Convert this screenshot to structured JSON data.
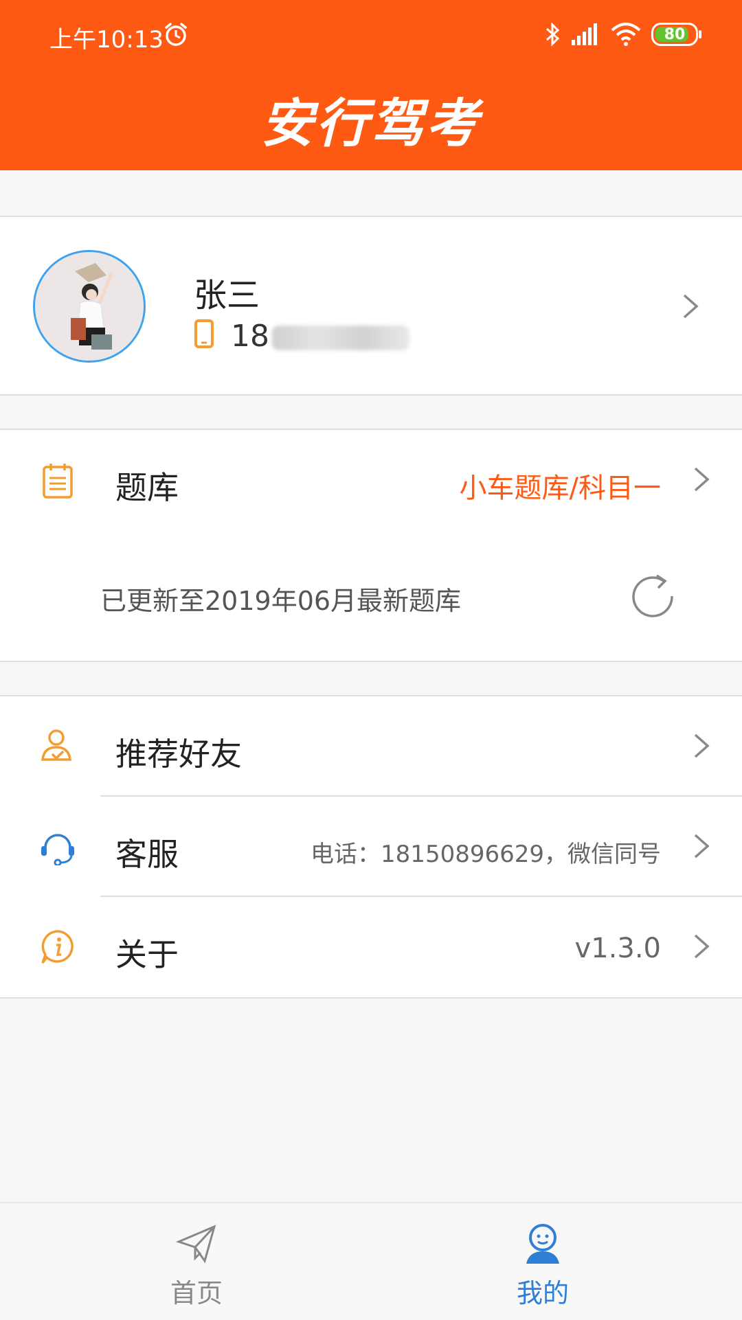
{
  "status_bar": {
    "time": "上午10:13",
    "battery": "80"
  },
  "app": {
    "title": "安行驾考"
  },
  "profile": {
    "name": "张三",
    "phone_prefix": "18"
  },
  "question_bank": {
    "label": "题库",
    "value": "小车题库/科目一",
    "update_text": "已更新至2019年06月最新题库"
  },
  "menu": {
    "recommend": {
      "label": "推荐好友"
    },
    "service": {
      "label": "客服",
      "value": "电话：18150896629，微信同号"
    },
    "about": {
      "label": "关于",
      "value": "v1.3.0"
    }
  },
  "bottom_nav": {
    "home": {
      "label": "首页"
    },
    "mine": {
      "label": "我的"
    }
  },
  "colors": {
    "brand": "#ff5a14",
    "accent_blue": "#2f7fd6",
    "icon_orange": "#f39c30"
  }
}
